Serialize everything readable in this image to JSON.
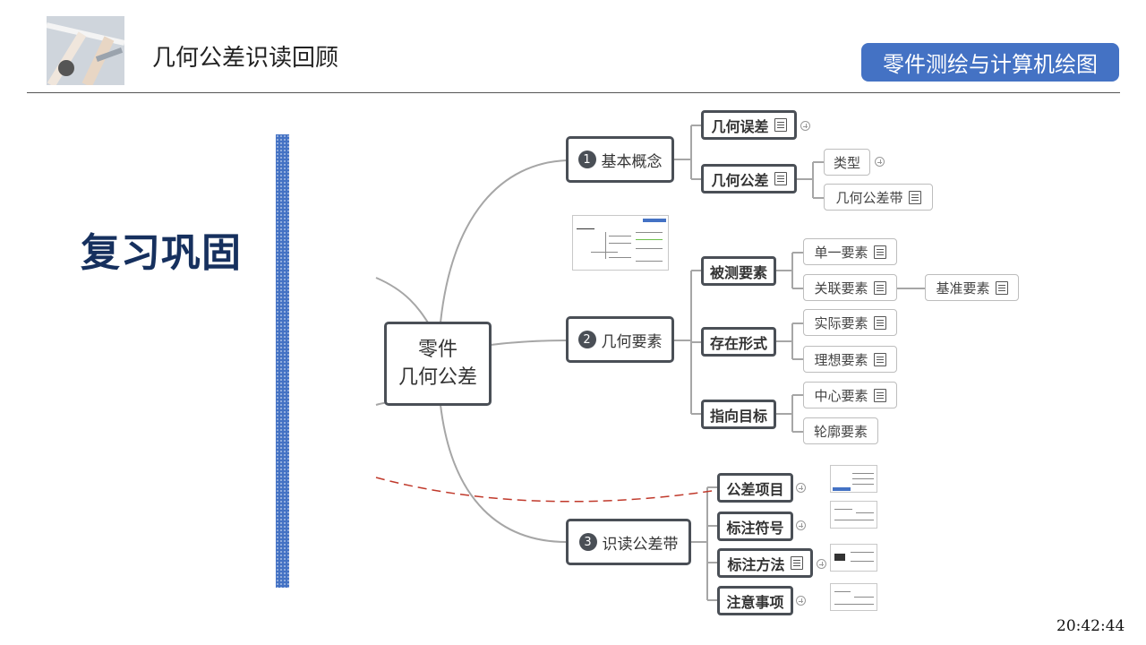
{
  "header": {
    "title": "几何公差识读回顾",
    "course_button": "零件测绘与计算机绘图"
  },
  "sidebar": {
    "review_label": "复习巩固"
  },
  "mindmap": {
    "central": {
      "line1": "零件",
      "line2": "几何公差"
    },
    "branches": [
      {
        "number": "1",
        "label": "基本概念"
      },
      {
        "number": "2",
        "label": "几何要素"
      },
      {
        "number": "3",
        "label": "识读公差带"
      }
    ],
    "basic": {
      "geometric_error": "几何误差",
      "geometric_tolerance": "几何公差",
      "type": "类型",
      "tolerance_zone": "几何公差带"
    },
    "elements": {
      "measured": "被测要素",
      "single": "单一要素",
      "associated": "关联要素",
      "datum": "基准要素",
      "existence": "存在形式",
      "actual": "实际要素",
      "ideal": "理想要素",
      "target": "指向目标",
      "center": "中心要素",
      "contour": "轮廓要素"
    },
    "reading": {
      "items": "公差项目",
      "symbols": "标注符号",
      "method": "标注方法",
      "notes": "注意事项"
    }
  },
  "status": {
    "clock": "20:42:44"
  },
  "colors": {
    "accent_blue": "#4472c4",
    "heading_navy": "#16305e",
    "node_border": "#4a4f56",
    "dashed_link": "#c0392b"
  }
}
